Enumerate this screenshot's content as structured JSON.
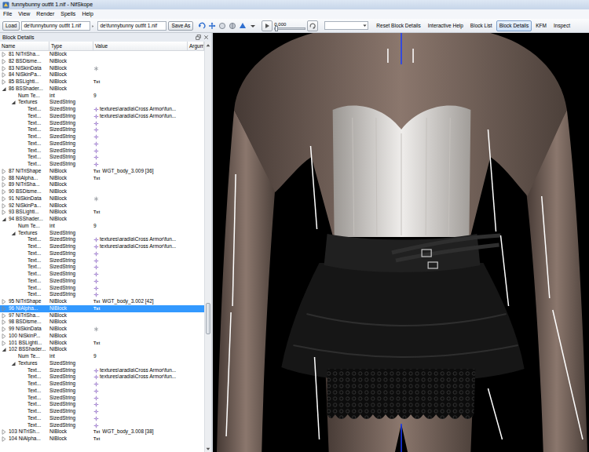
{
  "window": {
    "title": "funnybunny outfit 1.nif - NifSkope"
  },
  "menu": [
    "File",
    "View",
    "Render",
    "Spells",
    "Help"
  ],
  "toolbar": {
    "load": "Load",
    "paths": [
      "de\\funnybunny outfit 1.nif",
      "de\\funnybunny outfit 1.nif"
    ],
    "save_as": "Save As",
    "time": "0.000",
    "time_level": 0,
    "buttons": [
      {
        "label": "Reset Block Details",
        "selected": false
      },
      {
        "label": "Interactive Help",
        "selected": false
      },
      {
        "label": "Block List",
        "selected": false
      },
      {
        "label": "Block Details",
        "selected": true
      },
      {
        "label": "KFM",
        "selected": false
      },
      {
        "label": "Inspect",
        "selected": false
      }
    ]
  },
  "dock": {
    "title": "Block Details"
  },
  "table": {
    "columns": [
      "Name",
      "Type",
      "Value",
      "Argum"
    ],
    "scroll_level": 0.7,
    "rows": [
      {
        "depth": 0,
        "name": "81 NiTriSha...",
        "type": "NiBlock",
        "kind": "plain",
        "tag": "",
        "value": "",
        "expandable": true,
        "expanded": false,
        "selected": false
      },
      {
        "depth": 0,
        "name": "82 BSDisme...",
        "type": "NiBlock",
        "kind": "plain",
        "tag": "",
        "value": "",
        "expandable": true,
        "expanded": false,
        "selected": false
      },
      {
        "depth": 0,
        "name": "83 NiSkinData",
        "type": "NiBlock",
        "kind": "skin",
        "tag": "",
        "value": "",
        "expandable": true,
        "expanded": false,
        "selected": false
      },
      {
        "depth": 0,
        "name": "84 NiSkinPa...",
        "type": "NiBlock",
        "kind": "plain",
        "tag": "",
        "value": "",
        "expandable": true,
        "expanded": false,
        "selected": false
      },
      {
        "depth": 0,
        "name": "85 BSLighti...",
        "type": "NiBlock",
        "kind": "plain",
        "tag": "Txt",
        "value": "",
        "expandable": true,
        "expanded": false,
        "selected": false
      },
      {
        "depth": 0,
        "name": "86 BSShader...",
        "type": "NiBlock",
        "kind": "plain",
        "tag": "",
        "value": "",
        "expandable": true,
        "expanded": true,
        "selected": false
      },
      {
        "depth": 1,
        "name": "Num Te...",
        "type": "int",
        "kind": "plain",
        "tag": "",
        "value": "9",
        "expandable": false,
        "expanded": false,
        "selected": false
      },
      {
        "depth": 1,
        "name": "Textures",
        "type": "SizedString",
        "kind": "plain",
        "tag": "",
        "value": "",
        "expandable": true,
        "expanded": true,
        "selected": false
      },
      {
        "depth": 2,
        "name": "Text...",
        "type": "SizedString",
        "kind": "texture",
        "tag": "",
        "value": "textures\\aradia\\Cross Armor\\fun...",
        "expandable": false,
        "expanded": false,
        "selected": false
      },
      {
        "depth": 2,
        "name": "Text...",
        "type": "SizedString",
        "kind": "texture",
        "tag": "",
        "value": "textures\\aradia\\Cross Armor\\fun...",
        "expandable": false,
        "expanded": false,
        "selected": false
      },
      {
        "depth": 2,
        "name": "Text...",
        "type": "SizedString",
        "kind": "texture",
        "tag": "",
        "value": "",
        "expandable": false,
        "expanded": false,
        "selected": false
      },
      {
        "depth": 2,
        "name": "Text...",
        "type": "SizedString",
        "kind": "texture",
        "tag": "",
        "value": "",
        "expandable": false,
        "expanded": false,
        "selected": false
      },
      {
        "depth": 2,
        "name": "Text...",
        "type": "SizedString",
        "kind": "texture",
        "tag": "",
        "value": "",
        "expandable": false,
        "expanded": false,
        "selected": false
      },
      {
        "depth": 2,
        "name": "Text...",
        "type": "SizedString",
        "kind": "texture",
        "tag": "",
        "value": "",
        "expandable": false,
        "expanded": false,
        "selected": false
      },
      {
        "depth": 2,
        "name": "Text...",
        "type": "SizedString",
        "kind": "texture",
        "tag": "",
        "value": "",
        "expandable": false,
        "expanded": false,
        "selected": false
      },
      {
        "depth": 2,
        "name": "Text...",
        "type": "SizedString",
        "kind": "texture",
        "tag": "",
        "value": "",
        "expandable": false,
        "expanded": false,
        "selected": false
      },
      {
        "depth": 2,
        "name": "Text...",
        "type": "SizedString",
        "kind": "texture",
        "tag": "",
        "value": "",
        "expandable": false,
        "expanded": false,
        "selected": false
      },
      {
        "depth": 0,
        "name": "87 NiTriShape",
        "type": "NiBlock",
        "kind": "plain",
        "tag": "Txt",
        "value": "WGT_body_3.009 [36]",
        "expandable": true,
        "expanded": false,
        "selected": false
      },
      {
        "depth": 0,
        "name": "88 NiAlpha...",
        "type": "NiBlock",
        "kind": "plain",
        "tag": "Txt",
        "value": "",
        "expandable": true,
        "expanded": false,
        "selected": false
      },
      {
        "depth": 0,
        "name": "89 NiTriSha...",
        "type": "NiBlock",
        "kind": "plain",
        "tag": "",
        "value": "",
        "expandable": true,
        "expanded": false,
        "selected": false
      },
      {
        "depth": 0,
        "name": "90 BSDisme...",
        "type": "NiBlock",
        "kind": "plain",
        "tag": "",
        "value": "",
        "expandable": true,
        "expanded": false,
        "selected": false
      },
      {
        "depth": 0,
        "name": "91 NiSkinData",
        "type": "NiBlock",
        "kind": "skin",
        "tag": "",
        "value": "",
        "expandable": true,
        "expanded": false,
        "selected": false
      },
      {
        "depth": 0,
        "name": "92 NiSkinPa...",
        "type": "NiBlock",
        "kind": "plain",
        "tag": "",
        "value": "",
        "expandable": true,
        "expanded": false,
        "selected": false
      },
      {
        "depth": 0,
        "name": "93 BSLighti...",
        "type": "NiBlock",
        "kind": "plain",
        "tag": "Txt",
        "value": "",
        "expandable": true,
        "expanded": false,
        "selected": false
      },
      {
        "depth": 0,
        "name": "94 BSShader...",
        "type": "NiBlock",
        "kind": "plain",
        "tag": "",
        "value": "",
        "expandable": true,
        "expanded": true,
        "selected": false
      },
      {
        "depth": 1,
        "name": "Num Te...",
        "type": "int",
        "kind": "plain",
        "tag": "",
        "value": "9",
        "expandable": false,
        "expanded": false,
        "selected": false
      },
      {
        "depth": 1,
        "name": "Textures",
        "type": "SizedString",
        "kind": "plain",
        "tag": "",
        "value": "",
        "expandable": true,
        "expanded": true,
        "selected": false
      },
      {
        "depth": 2,
        "name": "Text...",
        "type": "SizedString",
        "kind": "texture",
        "tag": "",
        "value": "textures\\aradia\\Cross Armor\\fun...",
        "expandable": false,
        "expanded": false,
        "selected": false
      },
      {
        "depth": 2,
        "name": "Text...",
        "type": "SizedString",
        "kind": "texture",
        "tag": "",
        "value": "textures\\aradia\\Cross Armor\\fun...",
        "expandable": false,
        "expanded": false,
        "selected": false
      },
      {
        "depth": 2,
        "name": "Text...",
        "type": "SizedString",
        "kind": "texture",
        "tag": "",
        "value": "",
        "expandable": false,
        "expanded": false,
        "selected": false
      },
      {
        "depth": 2,
        "name": "Text...",
        "type": "SizedString",
        "kind": "texture",
        "tag": "",
        "value": "",
        "expandable": false,
        "expanded": false,
        "selected": false
      },
      {
        "depth": 2,
        "name": "Text...",
        "type": "SizedString",
        "kind": "texture",
        "tag": "",
        "value": "",
        "expandable": false,
        "expanded": false,
        "selected": false
      },
      {
        "depth": 2,
        "name": "Text...",
        "type": "SizedString",
        "kind": "texture",
        "tag": "",
        "value": "",
        "expandable": false,
        "expanded": false,
        "selected": false
      },
      {
        "depth": 2,
        "name": "Text...",
        "type": "SizedString",
        "kind": "texture",
        "tag": "",
        "value": "",
        "expandable": false,
        "expanded": false,
        "selected": false
      },
      {
        "depth": 2,
        "name": "Text...",
        "type": "SizedString",
        "kind": "texture",
        "tag": "",
        "value": "",
        "expandable": false,
        "expanded": false,
        "selected": false
      },
      {
        "depth": 2,
        "name": "Text...",
        "type": "SizedString",
        "kind": "texture",
        "tag": "",
        "value": "",
        "expandable": false,
        "expanded": false,
        "selected": false
      },
      {
        "depth": 0,
        "name": "95 NiTriShape",
        "type": "NiBlock",
        "kind": "plain",
        "tag": "Txt",
        "value": "WGT_body_3.002 [42]",
        "expandable": true,
        "expanded": false,
        "selected": false
      },
      {
        "depth": 0,
        "name": "96 NiAlpha...",
        "type": "NiBlock",
        "kind": "plain",
        "tag": "Txt",
        "value": "",
        "expandable": true,
        "expanded": false,
        "selected": true
      },
      {
        "depth": 0,
        "name": "97 NiTriSha...",
        "type": "NiBlock",
        "kind": "plain",
        "tag": "",
        "value": "",
        "expandable": true,
        "expanded": false,
        "selected": false
      },
      {
        "depth": 0,
        "name": "98 BSDisme...",
        "type": "NiBlock",
        "kind": "plain",
        "tag": "",
        "value": "",
        "expandable": true,
        "expanded": false,
        "selected": false
      },
      {
        "depth": 0,
        "name": "99 NiSkinData",
        "type": "NiBlock",
        "kind": "skin",
        "tag": "",
        "value": "",
        "expandable": true,
        "expanded": false,
        "selected": false
      },
      {
        "depth": 0,
        "name": "100 NiSkinP...",
        "type": "NiBlock",
        "kind": "plain",
        "tag": "",
        "value": "",
        "expandable": true,
        "expanded": false,
        "selected": false
      },
      {
        "depth": 0,
        "name": "101 BSLighti...",
        "type": "NiBlock",
        "kind": "plain",
        "tag": "Txt",
        "value": "",
        "expandable": true,
        "expanded": false,
        "selected": false
      },
      {
        "depth": 0,
        "name": "102 BSShader...",
        "type": "NiBlock",
        "kind": "plain",
        "tag": "",
        "value": "",
        "expandable": true,
        "expanded": true,
        "selected": false
      },
      {
        "depth": 1,
        "name": "Num Te...",
        "type": "int",
        "kind": "plain",
        "tag": "",
        "value": "9",
        "expandable": false,
        "expanded": false,
        "selected": false
      },
      {
        "depth": 1,
        "name": "Textures",
        "type": "SizedString",
        "kind": "plain",
        "tag": "",
        "value": "",
        "expandable": true,
        "expanded": true,
        "selected": false
      },
      {
        "depth": 2,
        "name": "Text...",
        "type": "SizedString",
        "kind": "texture",
        "tag": "",
        "value": "textures\\aradia\\Cross Armor\\fun...",
        "expandable": false,
        "expanded": false,
        "selected": false
      },
      {
        "depth": 2,
        "name": "Text...",
        "type": "SizedString",
        "kind": "texture",
        "tag": "",
        "value": "textures\\aradia\\Cross Armor\\fun...",
        "expandable": false,
        "expanded": false,
        "selected": false
      },
      {
        "depth": 2,
        "name": "Text...",
        "type": "SizedString",
        "kind": "texture",
        "tag": "",
        "value": "",
        "expandable": false,
        "expanded": false,
        "selected": false
      },
      {
        "depth": 2,
        "name": "Text...",
        "type": "SizedString",
        "kind": "texture",
        "tag": "",
        "value": "",
        "expandable": false,
        "expanded": false,
        "selected": false
      },
      {
        "depth": 2,
        "name": "Text...",
        "type": "SizedString",
        "kind": "texture",
        "tag": "",
        "value": "",
        "expandable": false,
        "expanded": false,
        "selected": false
      },
      {
        "depth": 2,
        "name": "Text...",
        "type": "SizedString",
        "kind": "texture",
        "tag": "",
        "value": "",
        "expandable": false,
        "expanded": false,
        "selected": false
      },
      {
        "depth": 2,
        "name": "Text...",
        "type": "SizedString",
        "kind": "texture",
        "tag": "",
        "value": "",
        "expandable": false,
        "expanded": false,
        "selected": false
      },
      {
        "depth": 2,
        "name": "Text...",
        "type": "SizedString",
        "kind": "texture",
        "tag": "",
        "value": "",
        "expandable": false,
        "expanded": false,
        "selected": false
      },
      {
        "depth": 2,
        "name": "Text...",
        "type": "SizedString",
        "kind": "texture",
        "tag": "",
        "value": "",
        "expandable": false,
        "expanded": false,
        "selected": false
      },
      {
        "depth": 0,
        "name": "103 NiTriSh...",
        "type": "NiBlock",
        "kind": "plain",
        "tag": "Txt",
        "value": "WGT_body_3.008 [38]",
        "expandable": true,
        "expanded": false,
        "selected": false
      },
      {
        "depth": 0,
        "name": "104 NiAlpha...",
        "type": "NiBlock",
        "kind": "plain",
        "tag": "Txt",
        "value": "",
        "expandable": true,
        "expanded": false,
        "selected": false
      }
    ]
  }
}
